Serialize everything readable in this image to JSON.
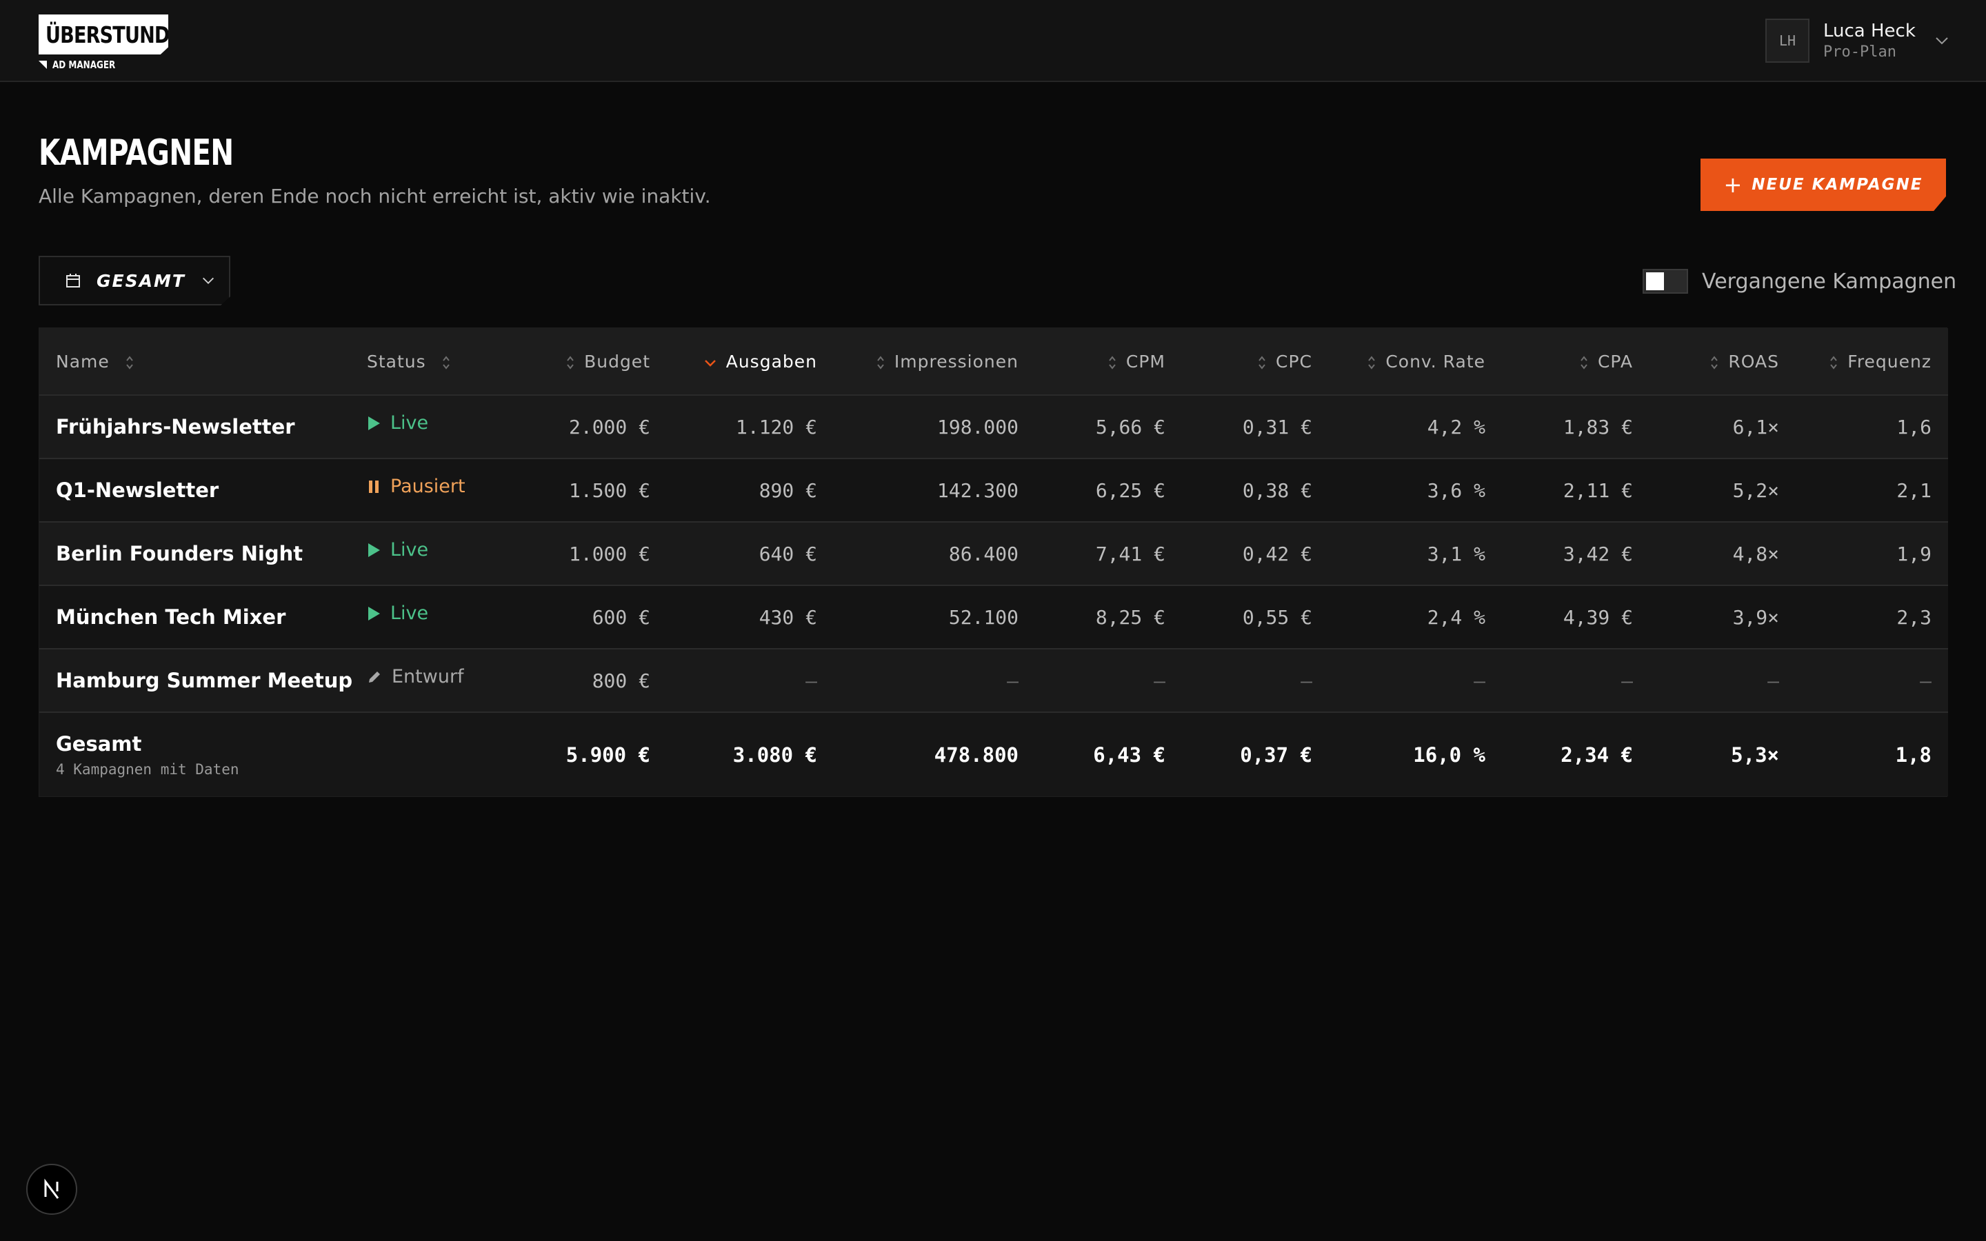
{
  "brand": {
    "name": "ÜBERSTUNDE",
    "mark": "®",
    "product": "AD MANAGER"
  },
  "user": {
    "initials": "LH",
    "name": "Luca Heck",
    "plan": "Pro-Plan"
  },
  "page": {
    "title": "KAMPAGNEN",
    "subtitle": "Alle Kampagnen, deren Ende noch nicht erreicht ist, aktiv wie inaktiv.",
    "new_button_label": "NEUE KAMPAGNE"
  },
  "filters": {
    "period_label": "GESAMT",
    "past_campaigns_label": "Vergangene Kampagnen",
    "past_campaigns_enabled": false
  },
  "table": {
    "columns": {
      "name": "Name",
      "status": "Status",
      "budget": "Budget",
      "spend": "Ausgaben",
      "impressions": "Impressionen",
      "cpm": "CPM",
      "cpc": "CPC",
      "conv_rate": "Conv. Rate",
      "cpa": "CPA",
      "roas": "ROAS",
      "frequency": "Frequenz"
    },
    "sorted_by": "Ausgaben",
    "sort_direction": "desc",
    "rows": [
      {
        "name": "Frühjahrs-Newsletter",
        "status": "Live",
        "status_kind": "live",
        "budget": "2.000 €",
        "spend": "1.120 €",
        "impressions": "198.000",
        "cpm": "5,66 €",
        "cpc": "0,31 €",
        "conv_rate": "4,2 %",
        "cpa": "1,83 €",
        "roas": "6,1×",
        "frequency": "1,6"
      },
      {
        "name": "Q1-Newsletter",
        "status": "Pausiert",
        "status_kind": "paused",
        "budget": "1.500 €",
        "spend": "890 €",
        "impressions": "142.300",
        "cpm": "6,25 €",
        "cpc": "0,38 €",
        "conv_rate": "3,6 %",
        "cpa": "2,11 €",
        "roas": "5,2×",
        "frequency": "2,1"
      },
      {
        "name": "Berlin Founders Night",
        "status": "Live",
        "status_kind": "live",
        "budget": "1.000 €",
        "spend": "640 €",
        "impressions": "86.400",
        "cpm": "7,41 €",
        "cpc": "0,42 €",
        "conv_rate": "3,1 %",
        "cpa": "3,42 €",
        "roas": "4,8×",
        "frequency": "1,9"
      },
      {
        "name": "München Tech Mixer",
        "status": "Live",
        "status_kind": "live",
        "budget": "600 €",
        "spend": "430 €",
        "impressions": "52.100",
        "cpm": "8,25 €",
        "cpc": "0,55 €",
        "conv_rate": "2,4 %",
        "cpa": "4,39 €",
        "roas": "3,9×",
        "frequency": "2,3"
      },
      {
        "name": "Hamburg Summer Meetup",
        "status": "Entwurf",
        "status_kind": "draft",
        "budget": "800 €",
        "spend": "—",
        "impressions": "—",
        "cpm": "—",
        "cpc": "—",
        "conv_rate": "—",
        "cpa": "—",
        "roas": "—",
        "frequency": "—"
      }
    ],
    "total": {
      "label": "Gesamt",
      "sub": "4 Kampagnen mit Daten",
      "budget": "5.900 €",
      "spend": "3.080 €",
      "impressions": "478.800",
      "cpm": "6,43 €",
      "cpc": "0,37 €",
      "conv_rate": "16,0 %",
      "cpa": "2,34 €",
      "roas": "5,3×",
      "frequency": "1,8"
    }
  },
  "dev_badge": "N",
  "colors": {
    "accent": "#ea5417",
    "live": "#4cc28a",
    "paused": "#f0a25a",
    "draft": "#a8a8a8",
    "background": "#0a0a0a"
  }
}
